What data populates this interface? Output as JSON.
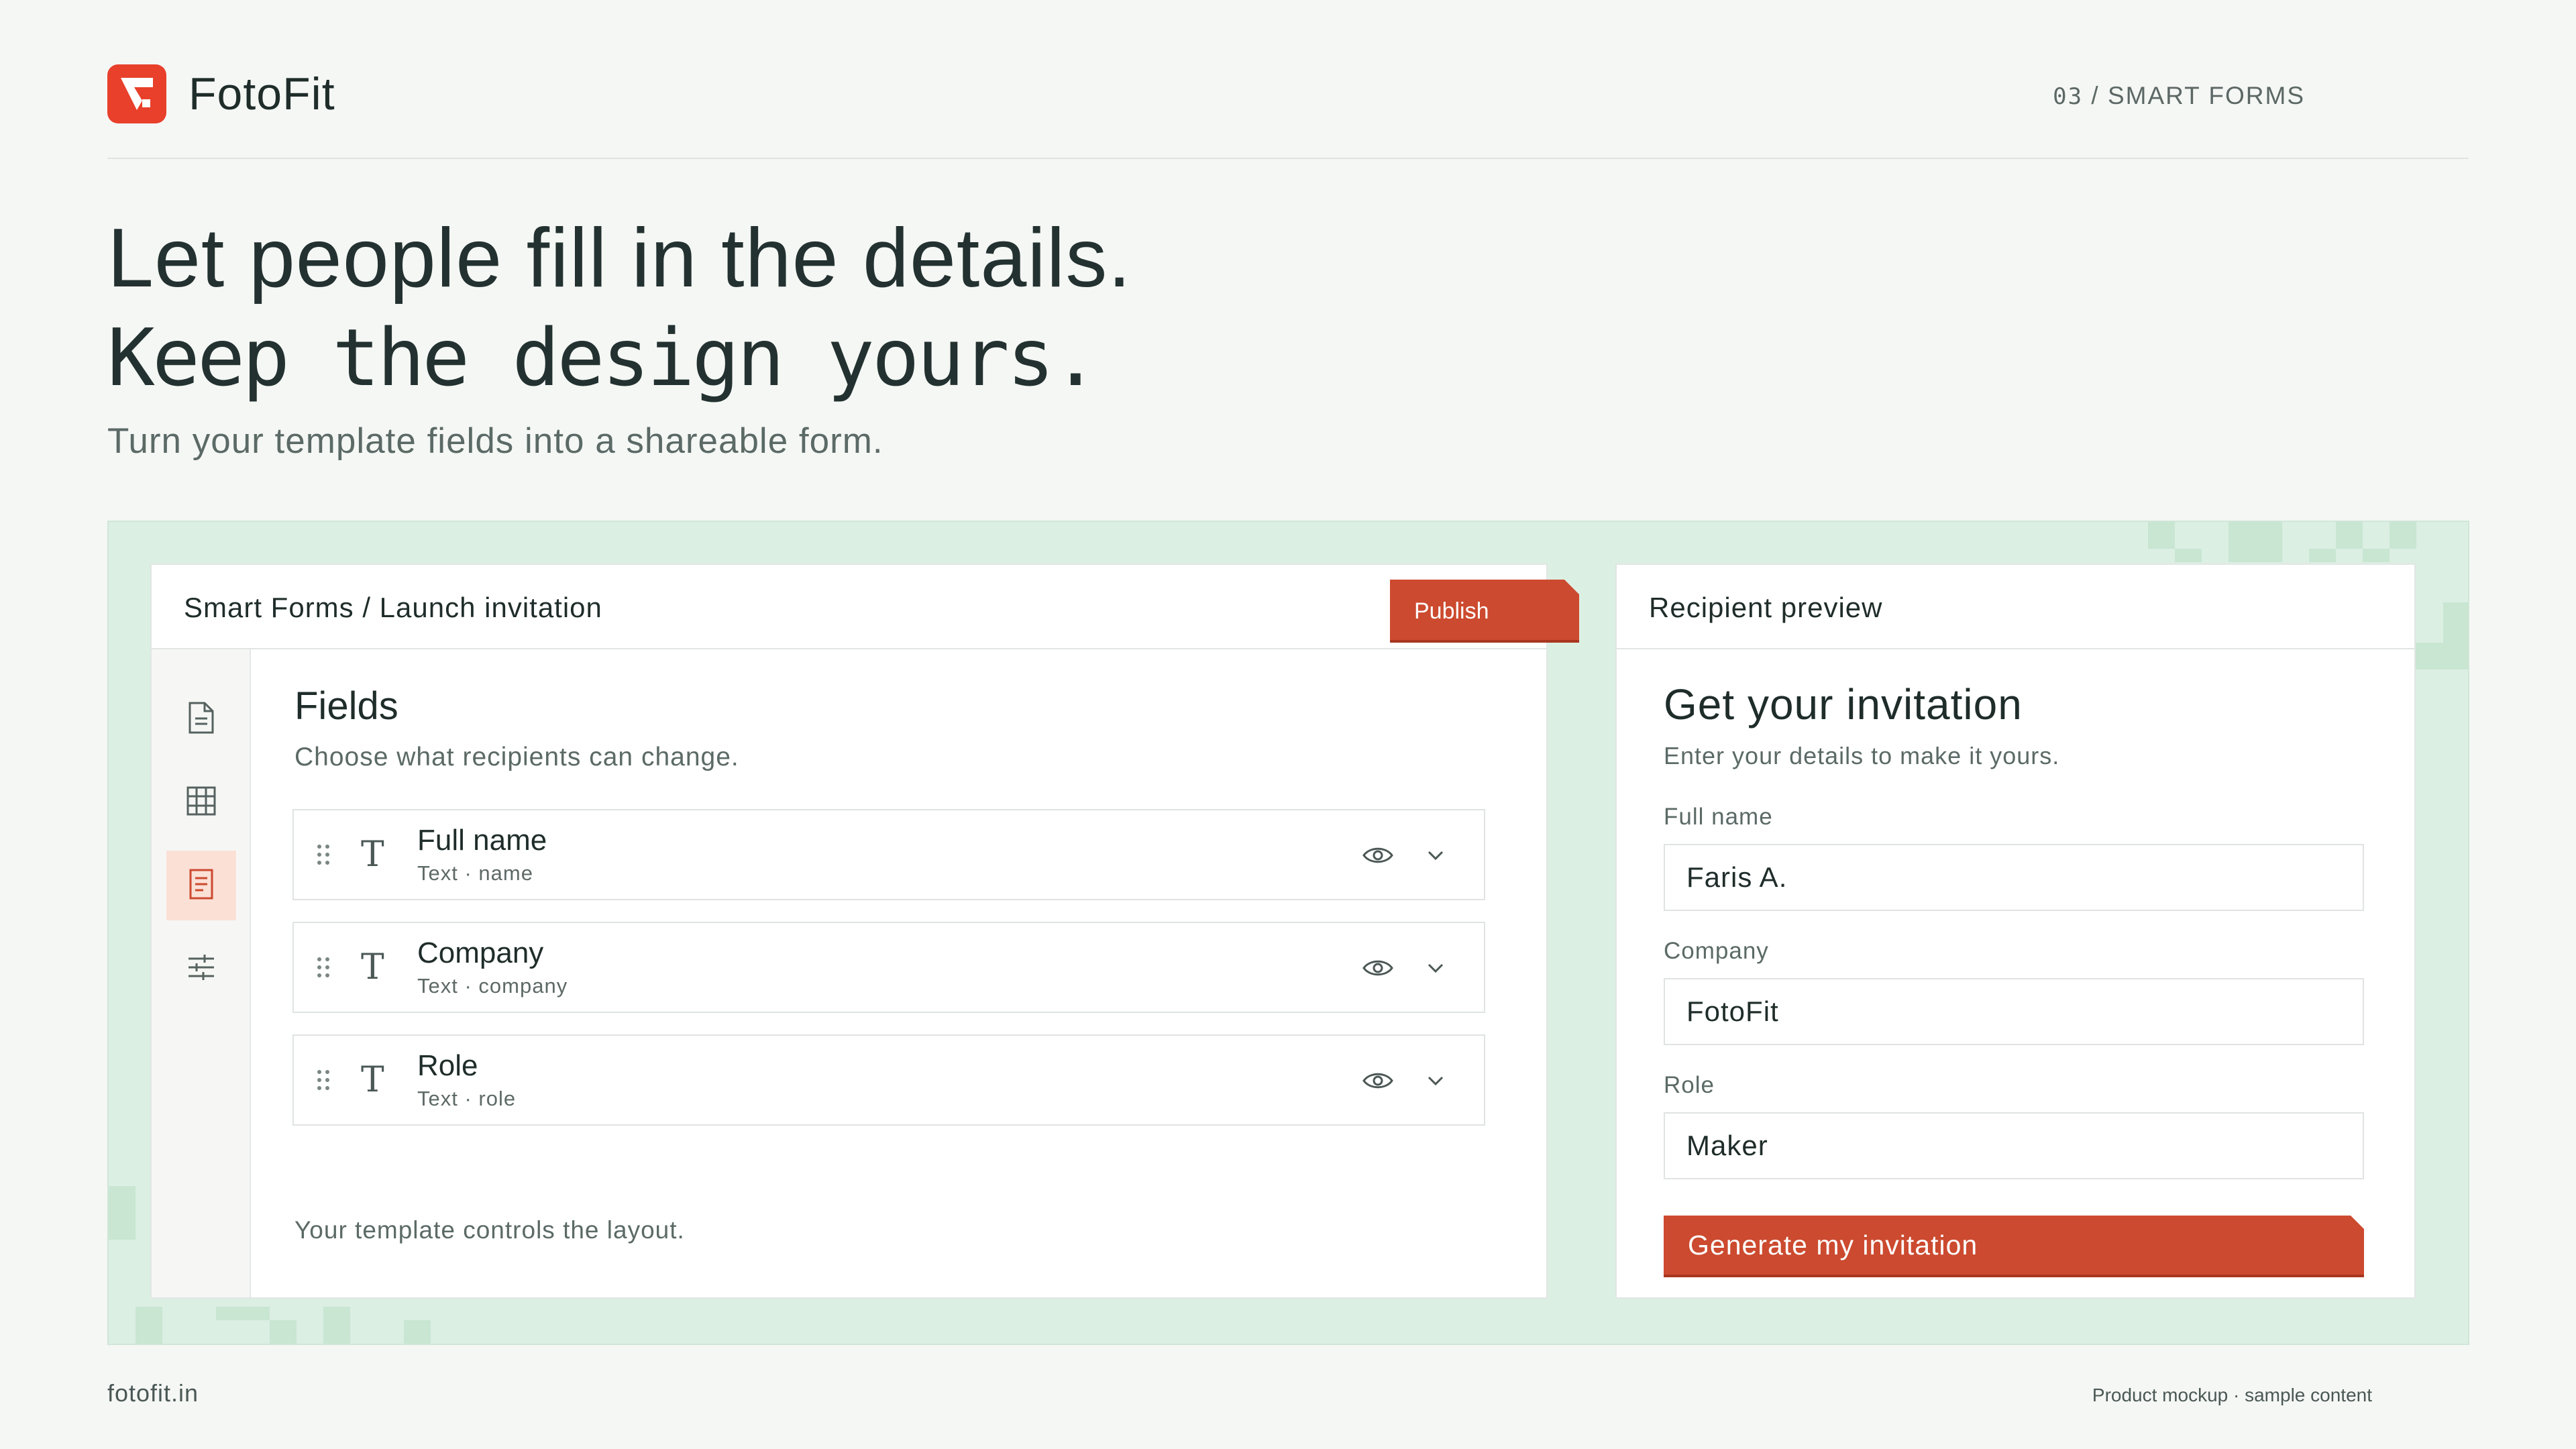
{
  "brand": {
    "name": "FotoFit",
    "logo_icon": "fotofit-logo-icon",
    "accent": "#e8402b"
  },
  "section": {
    "number": "03",
    "separator": "/",
    "label": "SMART FORMS"
  },
  "hero": {
    "line1": "Let people fill in the details.",
    "line2": "Keep the design yours.",
    "subtitle": "Turn your template fields into a shareable form."
  },
  "editor": {
    "breadcrumb": "Smart Forms / Launch invitation",
    "publish_label": "Publish",
    "rail": [
      {
        "icon": "document-icon",
        "active": false
      },
      {
        "icon": "grid-icon",
        "active": false
      },
      {
        "icon": "form-icon",
        "active": true
      },
      {
        "icon": "sliders-icon",
        "active": false
      }
    ],
    "fields_title": "Fields",
    "fields_subtitle": "Choose what recipients can change.",
    "fields": [
      {
        "name": "Full name",
        "meta": "Text · name"
      },
      {
        "name": "Company",
        "meta": "Text · company"
      },
      {
        "name": "Role",
        "meta": "Text · role"
      }
    ],
    "footnote": "Your template controls the layout."
  },
  "preview": {
    "header": "Recipient preview",
    "title": "Get your invitation",
    "subtitle": "Enter your details to make it yours.",
    "inputs": [
      {
        "label": "Full name",
        "value": "Faris A."
      },
      {
        "label": "Company",
        "value": "FotoFit"
      },
      {
        "label": "Role",
        "value": "Maker"
      }
    ],
    "button_label": "Generate my invitation"
  },
  "footer": {
    "site": "fotofit.in",
    "note": "Product mockup · sample content"
  },
  "colors": {
    "accent": "#cc4a2f",
    "stage_bg": "#dcefe3",
    "page_bg": "#f5f7f5"
  }
}
